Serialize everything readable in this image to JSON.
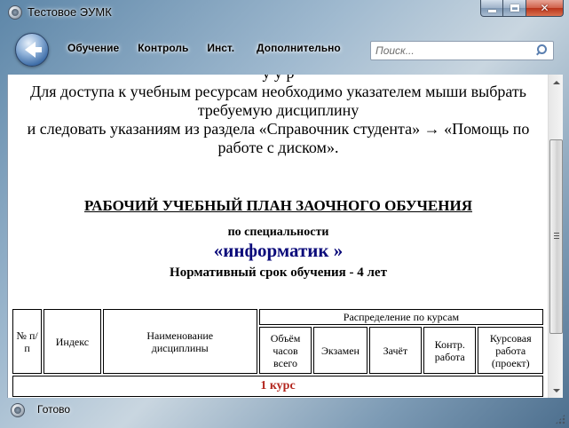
{
  "window": {
    "title": "Тестовое ЭУМК",
    "icon": "disc-icon"
  },
  "toolbar": {
    "back_icon": "back-arrow-icon",
    "menu": [
      {
        "label": "Обучение"
      },
      {
        "label": "Контроль"
      },
      {
        "label": "Инст."
      },
      {
        "label": "Дополнительно"
      }
    ],
    "search": {
      "placeholder": "Поиск...",
      "value": ""
    }
  },
  "content": {
    "cut_line": "у     у     р",
    "intro_line_1": "Для доступа к учебным ресурсам необходимо указателем мыши выбрать",
    "intro_line_2": "требуемую дисциплину",
    "intro_line_3": "и следовать указаниям из раздела «Справочник студента» → «Помощь по",
    "intro_line_4": "работе с диском».",
    "plan_title": "РАБОЧИЙ УЧЕБНЫЙ ПЛАН ЗАОЧНОГО ОБУЧЕНИЯ",
    "specialty_label": "по специальности",
    "specialty_name": "«информатик »",
    "term": "Нормативный срок обучения - 4 лет",
    "table": {
      "headers": {
        "number": "№ п/п",
        "index": "Индекс",
        "discipline": "Наименование дисциплины",
        "distribution": "Распределение по курсам",
        "hours": "Объём часов всего",
        "exam": "Экзамен",
        "credit": "Зачёт",
        "control_work": "Контр. работа",
        "course_work": "Курсовая работа (проект)"
      },
      "course_row": "1 курс"
    }
  },
  "status": {
    "text": "Готово"
  },
  "colors": {
    "specialty_name": "#0a0a7a",
    "course_row": "#b3261e"
  }
}
